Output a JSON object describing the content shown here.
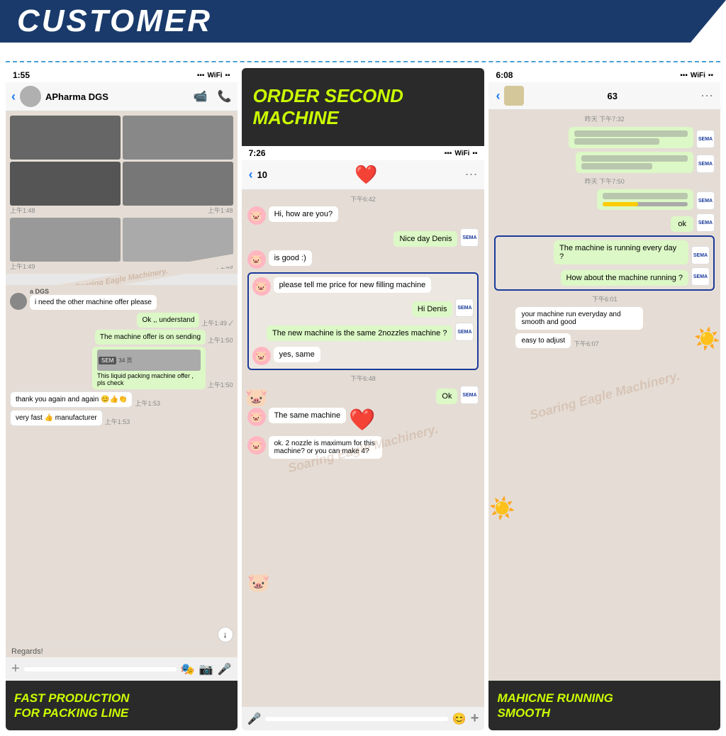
{
  "header": {
    "title": "CUSTOMER"
  },
  "left_panel": {
    "status_time": "1:55",
    "contact_name": "APharma DGS",
    "watermark": "Soaring Eagle Machinery.",
    "messages": [
      {
        "text": "i need the other machine offer please",
        "side": "left",
        "time": ""
      },
      {
        "text": "Ok ,, understand",
        "side": "right",
        "time": "上午1:49"
      },
      {
        "text": "The machine offer is on sending",
        "side": "right",
        "time": "上午1:50"
      },
      {
        "text": "This liquid packing machine offer , pls check",
        "side": "right",
        "time": "上午1:50"
      },
      {
        "text": "thank you again and again 😊👍👏",
        "side": "left",
        "time": "上午1:53"
      },
      {
        "text": "very fast 👍 manufacturer",
        "side": "left",
        "time": "上午1:53"
      }
    ],
    "footer_text": "Regards!",
    "bottom_label": "FAST PRODUCTION\nFOR PACKING LINE"
  },
  "middle_panel": {
    "banner_text": "ORDER SECOND\nMACHINE",
    "status_time": "7:26",
    "contact_num": "10",
    "messages": [
      {
        "text": "Hi, how are you?",
        "side": "left",
        "time": "下午6:42"
      },
      {
        "text": "Nice day Denis",
        "side": "right",
        "time": ""
      },
      {
        "text": "is good :)",
        "side": "left",
        "time": ""
      },
      {
        "text": "please tell me price for new filling machine",
        "side": "left",
        "time": ""
      },
      {
        "text": "Hi Denis",
        "side": "right",
        "time": ""
      },
      {
        "text": "The new machine is the same 2nozzles machine ?",
        "side": "right",
        "time": ""
      },
      {
        "text": "yes, same",
        "side": "left",
        "time": "下午6:48"
      },
      {
        "text": "Ok",
        "side": "right",
        "time": ""
      },
      {
        "text": "The same machine",
        "side": "left",
        "time": ""
      },
      {
        "text": "ok. 2 nozzle is maximum for this machine? or you can make 4?",
        "side": "left",
        "time": ""
      }
    ]
  },
  "right_panel": {
    "status_time": "6:08",
    "contact_num": "63",
    "watermark": "Soaring Eagle Machinery.",
    "messages_highlighted": [
      {
        "text": "The machine is running every day ?",
        "highlighted": true
      },
      {
        "text": "How about the machine running ?",
        "highlighted": true
      }
    ],
    "messages_reply": [
      {
        "text": "your machine run everyday and smooth and good",
        "side": "left"
      },
      {
        "text": "easy to adjust",
        "side": "left",
        "time": "下午6:07"
      }
    ],
    "bottom_label": "MAHICNE RUNNING\nSMOOTH",
    "time_labels": [
      "昨天 下午7:32",
      "昨天 下午7:50",
      "下午6:01"
    ]
  },
  "icons": {
    "back_arrow": "‹",
    "video_call": "📹",
    "phone_call": "📞",
    "more": "⋯",
    "add": "+",
    "emoji": "😊",
    "camera": "📷",
    "mic": "🎤",
    "signal_bars": "▪▪▪",
    "wifi": "WiFi",
    "battery": "🔋"
  },
  "colors": {
    "header_bg": "#1a3a6b",
    "header_text": "#ffffff",
    "accent_yellow": "#ccff00",
    "banner_bg": "#2a2a2a",
    "chat_bg": "#e5ddd5",
    "bubble_green": "#dcf8c6",
    "bubble_white": "#ffffff",
    "highlight_border": "#1a3a9b",
    "divider_blue": "#4a9fd4"
  }
}
